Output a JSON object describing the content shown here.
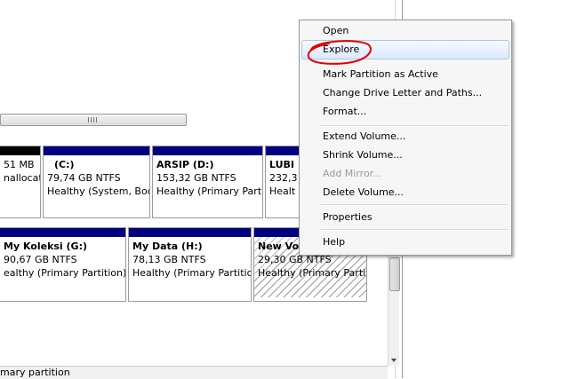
{
  "disks": {
    "row1": [
      {
        "name": "",
        "size": "51 MB",
        "status": "nallocat",
        "bar": "black"
      },
      {
        "name": "(C:)",
        "size": "79,74 GB NTFS",
        "status": "Healthy (System, Boo"
      },
      {
        "name": "ARSIP  (D:)",
        "size": "153,32 GB NTFS",
        "status": "Healthy (Primary Partit"
      },
      {
        "name": "LUBI",
        "size": "232,3",
        "status": "Healt"
      }
    ],
    "row2": [
      {
        "name": "My Koleksi  (G:)",
        "size": "90,67 GB NTFS",
        "status": "ealthy (Primary Partition)"
      },
      {
        "name": "My Data  (H:)",
        "size": "78,13 GB NTFS",
        "status": "Healthy (Primary Partition"
      },
      {
        "name": "New Vo",
        "size": "29,30 GB NTFS",
        "status": "Healthy (Primary Partiti"
      }
    ]
  },
  "status_bar": {
    "legend": "mary partition"
  },
  "context_menu": {
    "items": [
      {
        "label": "Open"
      },
      {
        "label": "Explore"
      },
      {
        "label": "Mark Partition as Active"
      },
      {
        "label": "Change Drive Letter and Paths..."
      },
      {
        "label": "Format..."
      },
      {
        "label": "Extend Volume..."
      },
      {
        "label": "Shrink Volume..."
      },
      {
        "label": "Add Mirror..."
      },
      {
        "label": "Delete Volume..."
      },
      {
        "label": "Properties"
      },
      {
        "label": "Help"
      }
    ]
  },
  "colors": {
    "partition_bar": "#00007e",
    "unallocated_bar": "#000000",
    "annotation": "#e00000",
    "menu_highlight": "#dbe9fb"
  }
}
